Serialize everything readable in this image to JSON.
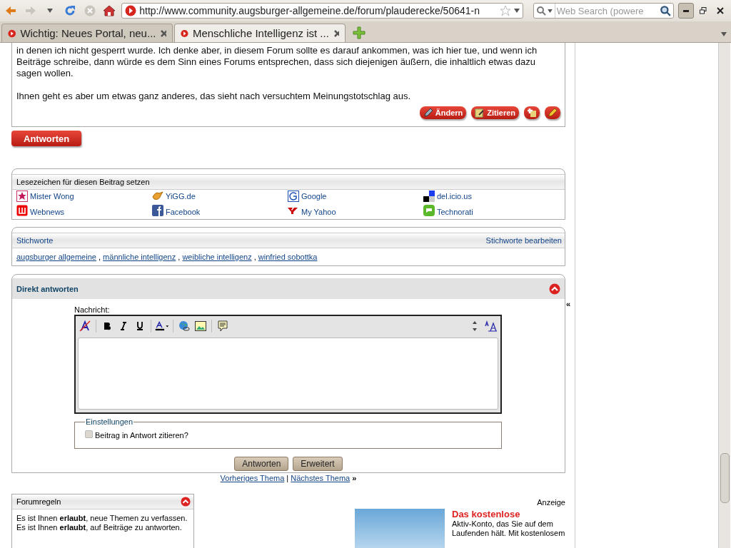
{
  "browser": {
    "url": "http://www.community.augsburger-allgemeine.de/forum/plauderecke/50641-n",
    "search_placeholder": "Web Search (powere",
    "tabs": [
      {
        "title": "Wichtig: Neues Portal, neu...",
        "selected": false
      },
      {
        "title": "Menschliche Intelligenz ist ...",
        "selected": true
      }
    ]
  },
  "post": {
    "paragraphs": [
      "in denen ich nicht gesperrt wurde. Ich denke aber, in diesem Forum sollte es darauf ankommen, was ich hier tue, und wenn ich Beiträge schreibe, dann würde es dem Sinn eines Forums entsprechen, dass sich diejenigen äußern, die inhaltlich etwas dazu sagen wollen.",
      "Ihnen geht es aber um etwas ganz anderes, das sieht nach versuchtem Meinungstotschlag aus."
    ],
    "actions": [
      {
        "kind": "edit",
        "label": "Ändern"
      },
      {
        "kind": "quote",
        "label": "Zitieren"
      },
      {
        "kind": "multiquote"
      },
      {
        "kind": "quickedit"
      }
    ]
  },
  "reply_button": "Antworten",
  "bookmarks": {
    "title": "Lesezeichen für diesen Beitrag setzen",
    "items": [
      {
        "label": "Mister Wong",
        "kind": "star"
      },
      {
        "label": "YiGG.de",
        "kind": "bird"
      },
      {
        "label": "Google",
        "kind": "g"
      },
      {
        "label": "del.icio.us",
        "kind": "squares"
      },
      {
        "label": "Webnews",
        "kind": "w"
      },
      {
        "label": "Facebook",
        "kind": "f"
      },
      {
        "label": "My Yahoo",
        "kind": "y"
      },
      {
        "label": "Technorati",
        "kind": "bubble"
      }
    ]
  },
  "tags": {
    "title": "Stichworte",
    "edit_link": "Stichworte bearbeiten",
    "items": [
      "augsburger allgemeine",
      "männliche intelligenz",
      "weibliche intelligenz",
      "winfried sobottka"
    ],
    "separator": ","
  },
  "quick_reply": {
    "title": "Direkt antworten",
    "message_label": "Nachricht:",
    "settings_legend": "Einstellungen",
    "quote_option": {
      "label": "Beitrag in Antwort zitieren?",
      "checked": false
    },
    "buttons": [
      "Antworten",
      "Erweitert"
    ]
  },
  "thread_nav": {
    "previous": "Vorheriges Thema",
    "separator": "|",
    "next": "Nächstes Thema",
    "arrow": "»"
  },
  "sidebar_toggle": "«",
  "rules": {
    "title": "Forumregeln",
    "lines": [
      "Es ist Ihnen **erlaubt**, neue Themen zu verfassen.",
      "Es ist Ihnen **erlaubt**, auf Beiträge zu antworten."
    ]
  },
  "ad": {
    "label": "Anzeige",
    "headline": "Das kostenlose",
    "text": "Aktiv-Konto, das Sie auf dem Laufenden hält. Mit kostenlosem"
  }
}
